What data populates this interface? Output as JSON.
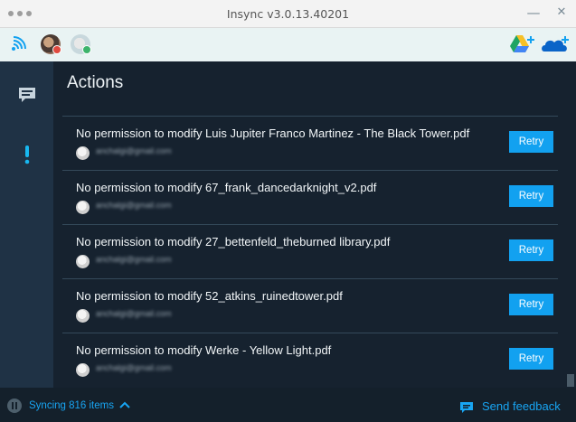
{
  "window": {
    "title": "Insync v3.0.13.40201",
    "minimize_glyph": "—",
    "close_glyph": "✕"
  },
  "accounts": {
    "icons": [
      "wifi-signal-icon",
      "account-avatar-1",
      "account-avatar-2",
      "add-google-drive-icon",
      "add-onedrive-icon"
    ]
  },
  "sidebar": {
    "items": [
      {
        "icon": "chat-icon",
        "active": false
      },
      {
        "icon": "exclamation-icon",
        "active": true
      }
    ]
  },
  "main": {
    "heading": "Actions",
    "actions": [
      {
        "message": "No permission to modify Luis Jupiter Franco Martinez - The Black Tower.pdf",
        "email": "anchalgi@gmail.com",
        "button": "Retry"
      },
      {
        "message": "No permission to modify 67_frank_dancedarknight_v2.pdf",
        "email": "anchalgi@gmail.com",
        "button": "Retry"
      },
      {
        "message": "No permission to modify 27_bettenfeld_theburned library.pdf",
        "email": "anchalgi@gmail.com",
        "button": "Retry"
      },
      {
        "message": "No permission to modify 52_atkins_ruinedtower.pdf",
        "email": "anchalgi@gmail.com",
        "button": "Retry"
      },
      {
        "message": "No permission to modify Werke - Yellow Light.pdf",
        "email": "anchalgi@gmail.com",
        "button": "Retry"
      }
    ]
  },
  "status": {
    "syncing": "Syncing 816 items",
    "feedback": "Send feedback"
  },
  "colors": {
    "accent": "#12a1f0",
    "background": "#16222f",
    "sidebar": "#1f3245",
    "alert": "#18b8f0"
  }
}
